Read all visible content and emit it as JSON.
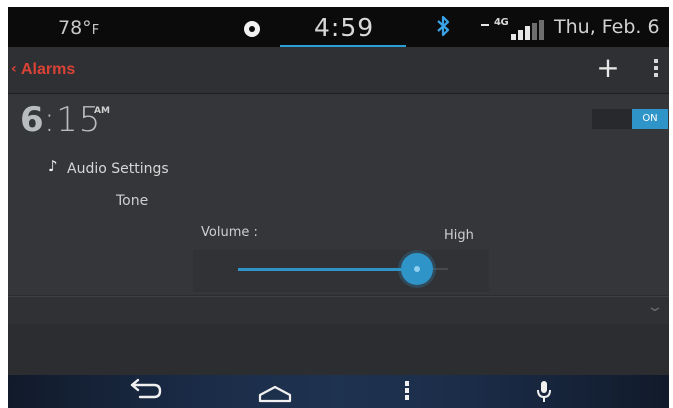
{
  "status_bar": {
    "temperature": "78°",
    "temperature_unit": "F",
    "clock": "4:59",
    "network": "4G",
    "date": "Thu, Feb. 6",
    "accent_color": "#2a9fd6",
    "bluetooth_color": "#3aa3e8"
  },
  "action_bar": {
    "back_glyph": "‹",
    "title": "Alarms",
    "title_color": "#d94336",
    "add_glyph": "+"
  },
  "alarm": {
    "hour": "6",
    "minutes": ":15",
    "meridiem": "AM",
    "toggle_label": "ON",
    "toggle_color": "#2f94c8",
    "audio_settings_label": "Audio Settings",
    "tone_label": "Tone",
    "volume_label": "Volume :",
    "volume_value_label": "High",
    "volume_level_percent": 85
  },
  "nav_bar": {
    "back_icon": "back-arrow-icon",
    "home_icon": "home-icon",
    "menu_icon": "menu-icon",
    "mic_icon": "microphone-icon"
  }
}
